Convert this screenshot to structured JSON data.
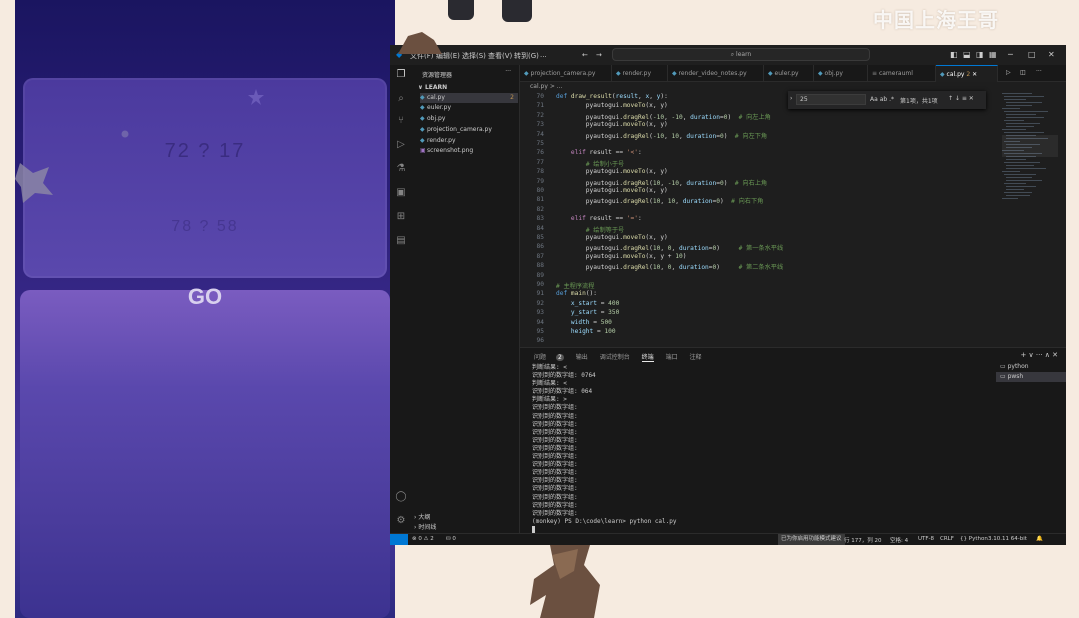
{
  "game": {
    "question_main": "72  ?  17",
    "question_faint": "78  ?  58",
    "go_label": "GO"
  },
  "overlay": {
    "watermark": "中国上海王哥"
  },
  "vscode": {
    "menu": [
      "文件(F)",
      "编辑(E)",
      "选择(S)",
      "查看(V)",
      "转到(G)",
      "..."
    ],
    "search_placeholder": "learn",
    "explorer": {
      "header": "资源管理器",
      "section": "LEARN",
      "files": [
        {
          "name": "cal.py",
          "badge": "2",
          "active": true
        },
        {
          "name": "euler.py"
        },
        {
          "name": "obj.py"
        },
        {
          "name": "projection_camera.py"
        },
        {
          "name": "render.py"
        },
        {
          "name": "screenshot.png"
        }
      ],
      "bottom_sections": [
        "大纲",
        "时间线"
      ]
    },
    "tabs": [
      {
        "label": "projection_camera.py"
      },
      {
        "label": "render.py"
      },
      {
        "label": "render_video_notes.py"
      },
      {
        "label": "euler.py"
      },
      {
        "label": "obj.py"
      },
      {
        "label": "camerauml"
      },
      {
        "label": "cal.py",
        "active": true,
        "badge": "2"
      }
    ],
    "breadcrumb": "cal.py > ...",
    "find": {
      "query": "25",
      "result": "第1项，共1项"
    },
    "code_lines": [
      {
        "n": "70",
        "html": "<span class=\"def\">def</span> <span class=\"fn\">draw_result</span>(<span class=\"var\">result</span>, <span class=\"var\">x</span>, <span class=\"var\">y</span>):"
      },
      {
        "n": "71",
        "html": "        pyautogui.<span class=\"fn\">moveTo</span>(x, y)"
      },
      {
        "n": "72",
        "html": "        pyautogui.<span class=\"fn\">dragRel</span>(<span class=\"num\">-10</span>, <span class=\"num\">-10</span>, <span class=\"var\">duration</span>=<span class=\"num\">0</span>)  <span class=\"cm\"># 向左上角</span>"
      },
      {
        "n": "73",
        "html": "        pyautogui.<span class=\"fn\">moveTo</span>(x, y)"
      },
      {
        "n": "74",
        "html": "        pyautogui.<span class=\"fn\">dragRel</span>(<span class=\"num\">-10</span>, <span class=\"num\">10</span>, <span class=\"var\">duration</span>=<span class=\"num\">0</span>)  <span class=\"cm\"># 向左下角</span>"
      },
      {
        "n": "75",
        "html": ""
      },
      {
        "n": "76",
        "html": "    <span class=\"kw\">elif</span> result == <span class=\"str\">'<'</span>:"
      },
      {
        "n": "77",
        "html": "        <span class=\"cm\"># 绘制小于号</span>"
      },
      {
        "n": "78",
        "html": "        pyautogui.<span class=\"fn\">moveTo</span>(x, y)"
      },
      {
        "n": "79",
        "html": "        pyautogui.<span class=\"fn\">dragRel</span>(<span class=\"num\">10</span>, <span class=\"num\">-10</span>, <span class=\"var\">duration</span>=<span class=\"num\">0</span>)  <span class=\"cm\"># 向右上角</span>"
      },
      {
        "n": "80",
        "html": "        pyautogui.<span class=\"fn\">moveTo</span>(x, y)"
      },
      {
        "n": "81",
        "html": "        pyautogui.<span class=\"fn\">dragRel</span>(<span class=\"num\">10</span>, <span class=\"num\">10</span>, <span class=\"var\">duration</span>=<span class=\"num\">0</span>)  <span class=\"cm\"># 向右下角</span>"
      },
      {
        "n": "82",
        "html": ""
      },
      {
        "n": "83",
        "html": "    <span class=\"kw\">elif</span> result == <span class=\"str\">'='</span>:"
      },
      {
        "n": "84",
        "html": "        <span class=\"cm\"># 绘制等于号</span>"
      },
      {
        "n": "85",
        "html": "        pyautogui.<span class=\"fn\">moveTo</span>(x, y)"
      },
      {
        "n": "86",
        "html": "        pyautogui.<span class=\"fn\">dragRel</span>(<span class=\"num\">10</span>, <span class=\"num\">0</span>, <span class=\"var\">duration</span>=<span class=\"num\">0</span>)     <span class=\"cm\"># 第一条水平线</span>"
      },
      {
        "n": "87",
        "html": "        pyautogui.<span class=\"fn\">moveTo</span>(x, y + <span class=\"num\">10</span>)"
      },
      {
        "n": "88",
        "html": "        pyautogui.<span class=\"fn\">dragRel</span>(<span class=\"num\">10</span>, <span class=\"num\">0</span>, <span class=\"var\">duration</span>=<span class=\"num\">0</span>)     <span class=\"cm\"># 第二条水平线</span>"
      },
      {
        "n": "89",
        "html": ""
      },
      {
        "n": "90",
        "html": "<span class=\"cm\"># 主程序流程</span>"
      },
      {
        "n": "91",
        "html": "<span class=\"def\">def</span> <span class=\"fn\">main</span>():"
      },
      {
        "n": "92",
        "html": "    <span class=\"var\">x_start</span> = <span class=\"num\">400</span>"
      },
      {
        "n": "93",
        "html": "    <span class=\"var\">y_start</span> = <span class=\"num\">350</span>"
      },
      {
        "n": "94",
        "html": "    <span class=\"var\">width</span> = <span class=\"num\">500</span>"
      },
      {
        "n": "95",
        "html": "    <span class=\"var\">height</span> = <span class=\"num\">100</span>"
      },
      {
        "n": "96",
        "html": ""
      }
    ],
    "panel_tabs": [
      "问题",
      "2",
      "输出",
      "调试控制台",
      "终端",
      "端口",
      "注释"
    ],
    "terminal_lines": [
      "判断结果: <",
      "识别到的数字组: 0764",
      "判断结果: <",
      "识别到的数字组: 064",
      "判断结果: >",
      "识别到的数字组:",
      "识别到的数字组:",
      "识别到的数字组:",
      "识别到的数字组:",
      "识别到的数字组:",
      "识别到的数字组:",
      "识别到的数字组:",
      "识别到的数字组:",
      "识别到的数字组:",
      "识别到的数字组:",
      "识别到的数字组:",
      "识别到的数字组:",
      "识别到的数字组:",
      "识别到的数字组:",
      "(monkey) PS D:\\code\\learn> python cal.py"
    ],
    "terminal_list": [
      "python",
      "pwsh"
    ],
    "status": {
      "problems": "⊗ 0 ⚠ 2",
      "ports": "⛁ 0",
      "mode": "已为你启用功能模式建议",
      "position": "行 177，列 20",
      "spaces": "空格: 4",
      "encoding": "UTF-8",
      "eol": "CRLF",
      "language": "{} Python",
      "interpreter": "3.10.11 64-bit"
    }
  }
}
